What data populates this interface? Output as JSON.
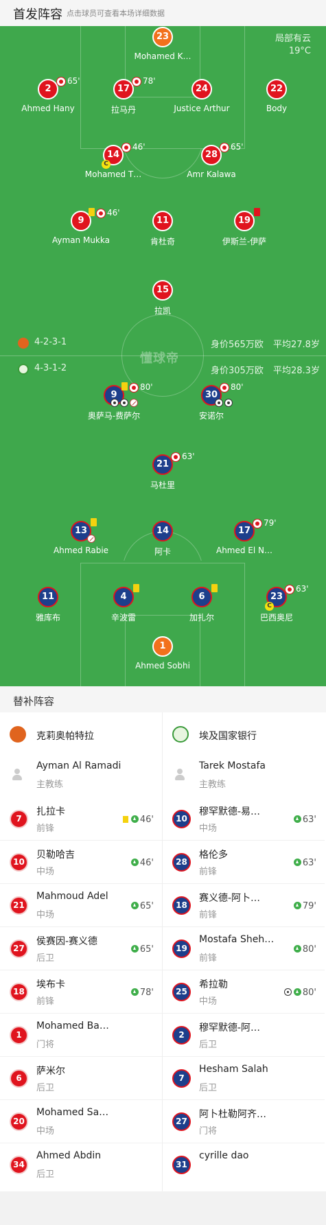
{
  "header": {
    "title": "首发阵容",
    "hint": "点击球员可查看本场详细数据"
  },
  "weather": {
    "condition": "局部有云",
    "temp": "19°C"
  },
  "watermark": "懂球帝",
  "home": {
    "formation": "4-2-3-1",
    "value": "身价565万欧",
    "age": "平均27.8岁",
    "logo_color": "#e0641e",
    "players": [
      {
        "num": "23",
        "name": "Mohamed K…",
        "gk": true
      },
      {
        "num": "2",
        "name": "Ahmed Hany",
        "sub": "65'"
      },
      {
        "num": "17",
        "name": "拉马丹",
        "sub": "78'"
      },
      {
        "num": "24",
        "name": "Justice Arthur"
      },
      {
        "num": "22",
        "name": "Body"
      },
      {
        "num": "14",
        "name": "Mohamed T…",
        "sub": "46'",
        "captain": "C"
      },
      {
        "num": "28",
        "name": "Amr Kalawa",
        "sub": "65'"
      },
      {
        "num": "9",
        "name": "Ayman Mukka",
        "sub": "46'"
      },
      {
        "num": "11",
        "name": "肯杜奇"
      },
      {
        "num": "19",
        "name": "伊斯兰-伊萨"
      },
      {
        "num": "15",
        "name": "拉凯"
      }
    ]
  },
  "away": {
    "formation": "4-3-1-2",
    "value": "身价305万欧",
    "age": "平均28.3岁",
    "logo_color": "#3a9a3a",
    "players": [
      {
        "num": "9",
        "name": "奥萨马-费萨尔",
        "sub": "80'"
      },
      {
        "num": "30",
        "name": "安诺尔",
        "sub": "80'"
      },
      {
        "num": "21",
        "name": "马杜里",
        "sub": "63'"
      },
      {
        "num": "13",
        "name": "Ahmed Rabie"
      },
      {
        "num": "14",
        "name": "阿卡"
      },
      {
        "num": "17",
        "name": "Ahmed El N…",
        "sub": "79'"
      },
      {
        "num": "11",
        "name": "雅库布"
      },
      {
        "num": "4",
        "name": "辛波雷"
      },
      {
        "num": "6",
        "name": "加扎尔"
      },
      {
        "num": "23",
        "name": "巴西奥尼",
        "sub": "63'",
        "captain": "C"
      },
      {
        "num": "1",
        "name": "Ahmed Sobhi",
        "gk": true
      }
    ]
  },
  "subs": {
    "title": "替补阵容",
    "home": {
      "team": "克莉奥帕特拉",
      "coach": {
        "name": "Ayman Al Ramadi",
        "role": "主教练"
      },
      "players": [
        {
          "num": "7",
          "name": "扎拉卡",
          "role": "前锋",
          "time": "46'",
          "yellow": true
        },
        {
          "num": "10",
          "name": "贝勒哈吉",
          "role": "中场",
          "time": "46'"
        },
        {
          "num": "21",
          "name": "Mahmoud Adel",
          "role": "中场",
          "time": "65'"
        },
        {
          "num": "27",
          "name": "侯赛因-赛义德",
          "role": "后卫",
          "time": "65'"
        },
        {
          "num": "18",
          "name": "埃布卡",
          "role": "前锋",
          "time": "78'"
        },
        {
          "num": "1",
          "name": "Mohamed Ba…",
          "role": "门将"
        },
        {
          "num": "6",
          "name": "萨米尔",
          "role": "后卫"
        },
        {
          "num": "20",
          "name": "Mohamed Sa…",
          "role": "中场"
        },
        {
          "num": "34",
          "name": "Ahmed Abdin",
          "role": "后卫"
        }
      ]
    },
    "away": {
      "team": "埃及国家银行",
      "coach": {
        "name": "Tarek Mostafa",
        "role": "主教练"
      },
      "players": [
        {
          "num": "10",
          "name": "穆罕默德-易…",
          "role": "中场",
          "time": "63'"
        },
        {
          "num": "28",
          "name": "格伦多",
          "role": "前锋",
          "time": "63'"
        },
        {
          "num": "18",
          "name": "赛义德-阿卜…",
          "role": "前锋",
          "time": "79'"
        },
        {
          "num": "19",
          "name": "Mostafa Sheh…",
          "role": "前锋",
          "time": "80'"
        },
        {
          "num": "25",
          "name": "希拉勒",
          "role": "中场",
          "time": "80'",
          "goal": true
        },
        {
          "num": "2",
          "name": "穆罕默德-阿…",
          "role": "后卫"
        },
        {
          "num": "7",
          "name": "Hesham Salah",
          "role": "后卫"
        },
        {
          "num": "27",
          "name": "阿卜杜勒阿齐…",
          "role": "门将"
        },
        {
          "num": "31",
          "name": "cyrille dao",
          "role": ""
        }
      ]
    }
  }
}
